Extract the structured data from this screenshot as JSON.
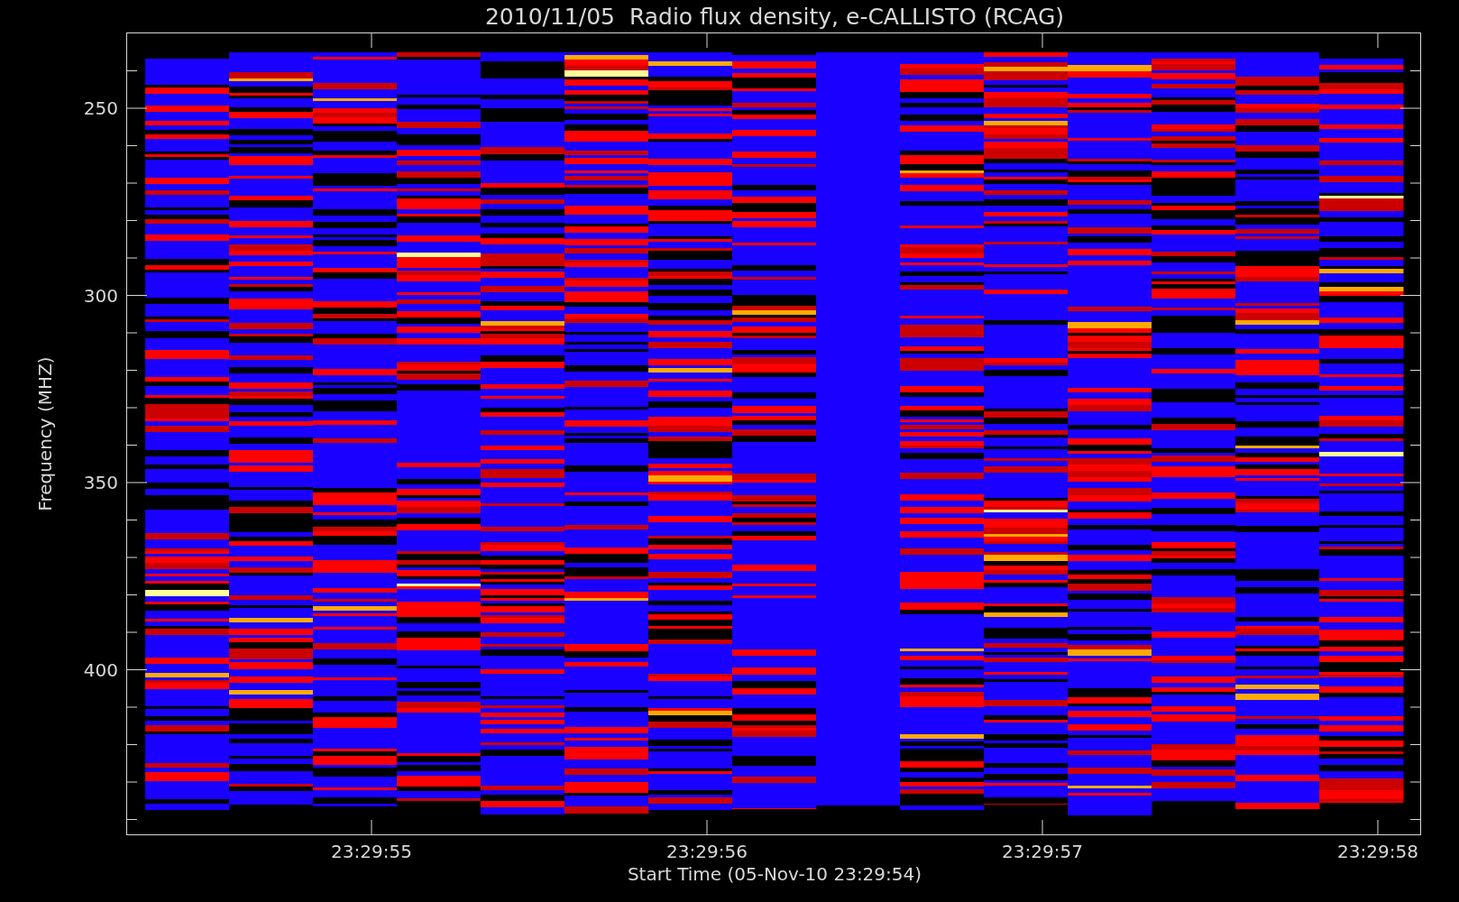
{
  "title": "2010/11/05  Radio flux density, e-CALLISTO (RCAG)",
  "y_axis": {
    "label": "Frequency (MHZ)",
    "ticks": [
      "250",
      "300",
      "350",
      "400"
    ]
  },
  "x_axis": {
    "label": "Start Time (05-Nov-10 23:29:54)",
    "ticks": [
      "23:29:55",
      "23:29:56",
      "23:29:57",
      "23:29:58"
    ]
  }
}
